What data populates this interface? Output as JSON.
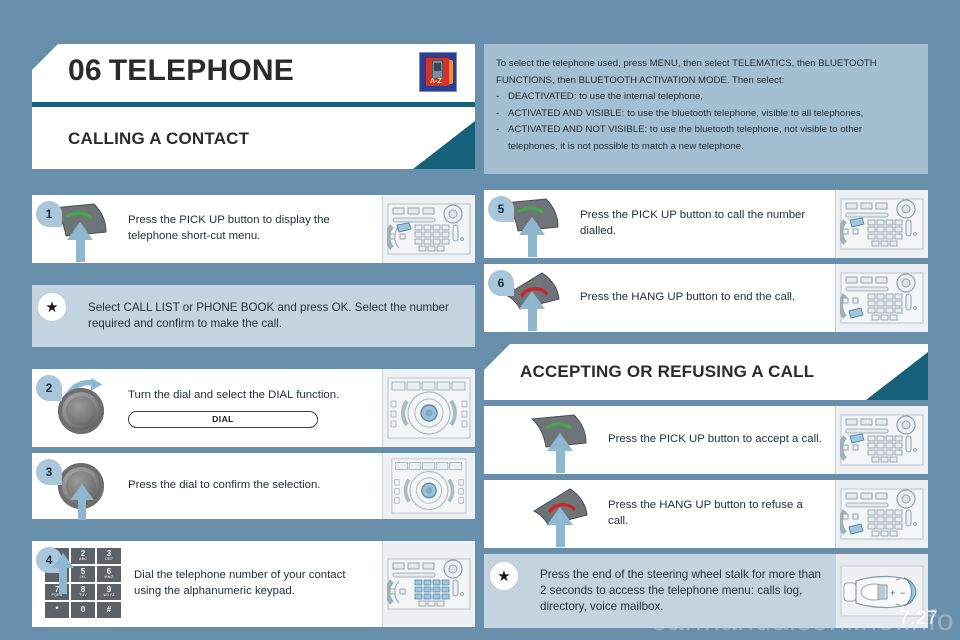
{
  "page": {
    "number": "7.27",
    "watermark": "carmanualsonline.info",
    "background_color": "#688fab",
    "accent_teal": "#16607a",
    "tip_bg": "#c3d4e0",
    "info_bg": "#a5bfd2",
    "badge_color": "#a9c6da"
  },
  "chapter": {
    "number": "06",
    "title": "TELEPHONE",
    "icon": "telephone-directory-icon",
    "icon_label": "A-Z"
  },
  "sections": {
    "calling": "CALLING A CONTACT",
    "accepting": "ACCEPTING OR REFUSING A CALL"
  },
  "info": {
    "paragraph": "To select the telephone used, press MENU, then select TELEMATICS, then BLUETOOTH FUNCTIONS, then BLUETOOTH ACTIVATION MODE. Then select:",
    "bullets": [
      "DEACTIVATED: to use the internal telephone,",
      "ACTIVATED AND VISIBLE: to use the bluetooth telephone, visible to all telephones,",
      "ACTIVATED AND NOT VISIBLE: to use the bluetooth telephone, not visible to other telephones, it is not possible to match a new telephone."
    ]
  },
  "left_steps": [
    {
      "number": "1",
      "text": "Press the PICK UP button to display the telephone short-cut menu.",
      "visual": "pick-up-handset-icon",
      "device": "audio-unit-keypad"
    },
    {
      "number": "2",
      "text": "Turn the dial and select the DIAL function.",
      "pill": "DIAL",
      "visual": "rotate-dial-icon",
      "device": "steering-wheel-controls"
    },
    {
      "number": "3",
      "text": "Press the dial to confirm the selection.",
      "visual": "press-dial-icon",
      "device": "steering-wheel-controls"
    },
    {
      "number": "4",
      "text": "Dial the telephone number of your contact using the alphanumeric keypad.",
      "visual": "alphanumeric-keypad-icon",
      "device": "audio-unit-keypad"
    }
  ],
  "left_tip": {
    "icon": "bulb-icon",
    "text": "Select CALL LIST or PHONE BOOK and press OK. Select the number required and confirm to make the call."
  },
  "right_steps": [
    {
      "number": "5",
      "text": "Press the PICK UP button to call the number dialled.",
      "visual": "pick-up-handset-icon",
      "device": "audio-unit-keypad"
    },
    {
      "number": "6",
      "text": "Press the HANG UP button to end the call.",
      "visual": "hang-up-handset-icon",
      "device": "audio-unit-keypad"
    }
  ],
  "accept_steps": [
    {
      "number": "",
      "text": "Press the PICK UP button to accept a call.",
      "visual": "pick-up-handset-icon",
      "device": "audio-unit-keypad"
    },
    {
      "number": "",
      "text": "Press the HANG UP button to refuse a call.",
      "visual": "hang-up-handset-icon",
      "device": "audio-unit-keypad"
    }
  ],
  "right_tip": {
    "icon": "bulb-icon",
    "text": "Press the end of the steering wheel stalk for more than 2 seconds to access the telephone menu: calls log, directory, voice mailbox.",
    "device": "steering-wheel-stalk"
  },
  "keypad": {
    "rows": [
      [
        {
          "d": "1",
          "l": ""
        },
        {
          "d": "2",
          "l": "ABC"
        },
        {
          "d": "3",
          "l": "DEF"
        }
      ],
      [
        {
          "d": "",
          "l": ""
        },
        {
          "d": "5",
          "l": "JKL"
        },
        {
          "d": "6",
          "l": "MNO"
        }
      ],
      [
        {
          "d": "7",
          "l": "PQRS"
        },
        {
          "d": "8",
          "l": "TUV"
        },
        {
          "d": "9",
          "l": "WXYZ"
        }
      ],
      [
        {
          "d": "*",
          "l": ""
        },
        {
          "d": "0",
          "l": ""
        },
        {
          "d": "#",
          "l": ""
        }
      ]
    ]
  }
}
